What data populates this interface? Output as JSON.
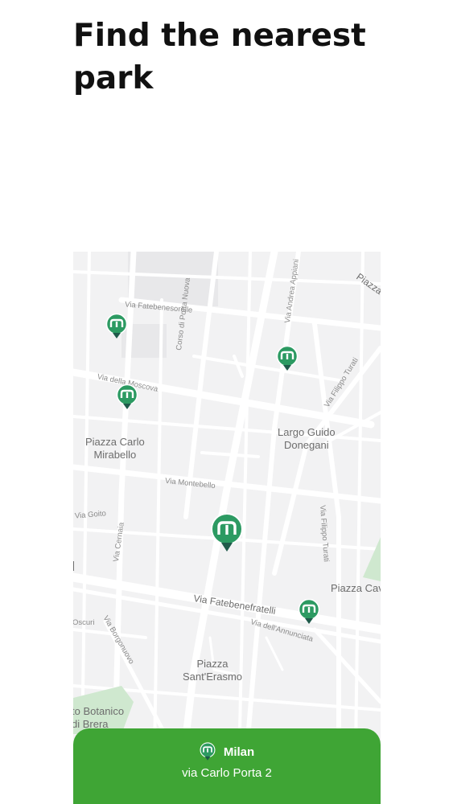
{
  "header": {
    "title": "Find the nearest park"
  },
  "map": {
    "places": [
      {
        "id": "piazza-carlo-mirabello",
        "line1": "Piazza Carlo",
        "line2": "Mirabello"
      },
      {
        "id": "largo-guido-donegani",
        "line1": "Largo Guido",
        "line2": "Donegani"
      },
      {
        "id": "piazza-sant-erasmo",
        "line1": "Piazza",
        "line2": "Sant'Erasmo"
      },
      {
        "id": "piazza-cavour",
        "line1": "Piazza Cav",
        "line2": ""
      },
      {
        "id": "orto-botanico",
        "line1": "to Botanico",
        "line2": "di Brera"
      },
      {
        "id": "piazza-top",
        "line1": "Piazza",
        "line2": ""
      }
    ],
    "streets": {
      "fatebenesorelle": "Via Fatebenesorelle",
      "moscova": "Via della Moscova",
      "corso_porta_nuova": "Corso di Porta Nuova",
      "andrea_appiani": "Via Andrea Appiani",
      "filippo_turati_top": "Via Filippo Turati",
      "montebello": "Via Montebello",
      "goito": "Via Goito",
      "cernaia": "Via Cernaia",
      "filippo_turati": "Via Filippo Turati",
      "fatebenefratelli": "Via Fatebenefratelli",
      "annunciata": "Via dell'Annunciata",
      "borgonuovo": "Via Borgonuovo",
      "oscuri": "Oscuri"
    },
    "marker_icon": "park-marker-icon",
    "selected_marker_icon": "selected-park-marker-icon"
  },
  "card": {
    "icon": "park-marker-icon",
    "city": "Milan",
    "address": "via Carlo Porta 2"
  },
  "colors": {
    "accent_green": "#3fa535",
    "marker_teal": "#1f8a8a",
    "marker_green": "#3ea84a"
  }
}
